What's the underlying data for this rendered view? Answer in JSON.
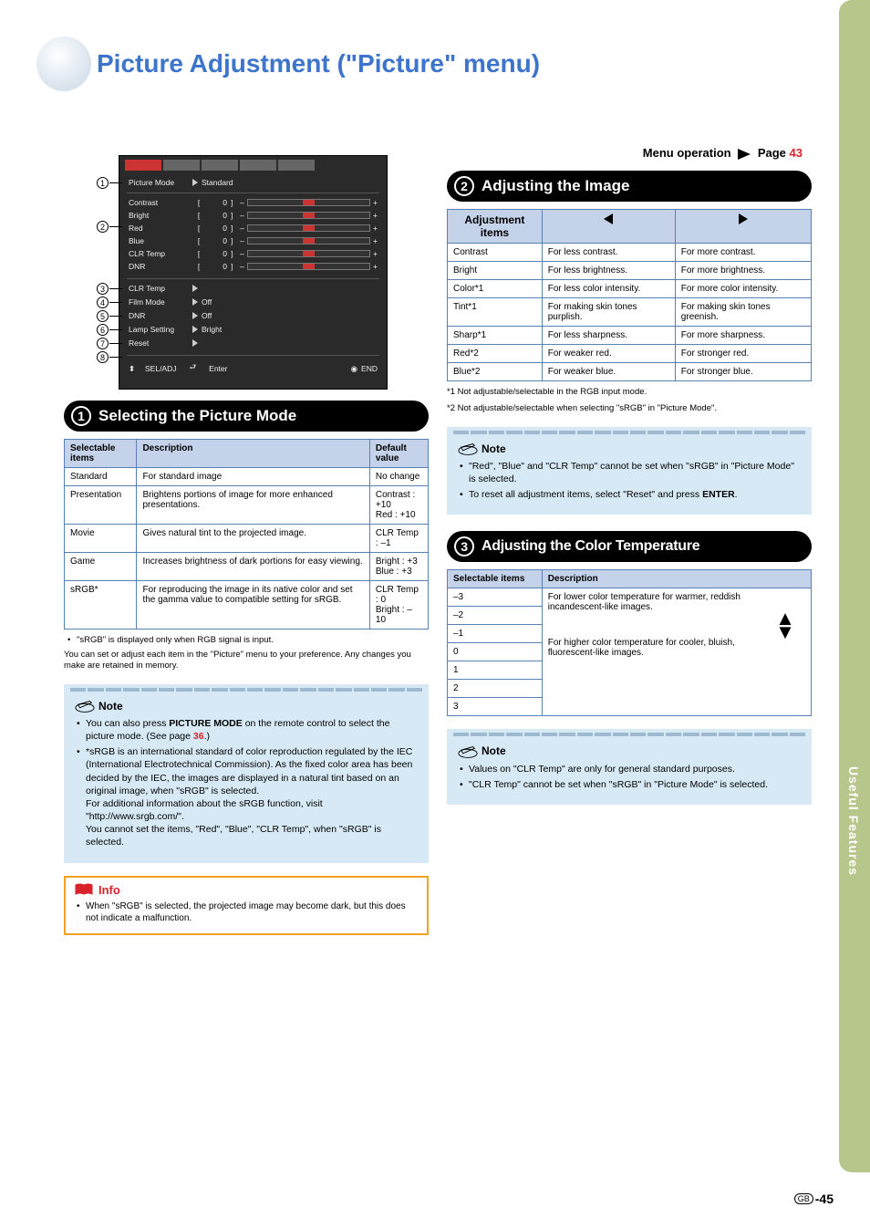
{
  "page": {
    "title": "Picture Adjustment (\"Picture\" menu)",
    "menu_operation_label": "Menu operation",
    "menu_operation_page_label": "Page",
    "menu_operation_page_num": "43",
    "side_tab": "Useful Features",
    "page_number_prefix": "GB",
    "page_number": "-45"
  },
  "callouts": [
    "1",
    "2",
    "3",
    "4",
    "5",
    "6",
    "7",
    "8"
  ],
  "menu_screenshot": {
    "tabs": [
      "Picture"
    ],
    "picture_mode_row": {
      "label": "Picture Mode",
      "value": "Standard"
    },
    "sliders": [
      {
        "label": "Contrast",
        "value": "0"
      },
      {
        "label": "Bright",
        "value": "0"
      },
      {
        "label": "Red",
        "value": "0"
      },
      {
        "label": "Blue",
        "value": "0"
      },
      {
        "label": "CLR Temp",
        "value": "0"
      },
      {
        "label": "DNR",
        "value": "0"
      }
    ],
    "items": [
      {
        "label": "CLR Temp"
      },
      {
        "label": "Film Mode",
        "value": "Off"
      },
      {
        "label": "DNR",
        "value": "Off"
      },
      {
        "label": "Lamp Setting",
        "value": "Bright"
      },
      {
        "label": "Reset"
      }
    ],
    "footer": {
      "sel_adj": "SEL/ADJ",
      "enter": "Enter",
      "end": "END"
    }
  },
  "section1": {
    "title": "Selecting the Picture Mode",
    "num": "1",
    "headers": [
      "Selectable items",
      "Description",
      "Default value"
    ],
    "rows": [
      {
        "c1": "Standard",
        "c2": "For standard image",
        "c3": "No change"
      },
      {
        "c1": "Presentation",
        "c2": "Brightens portions of image for more enhanced presentations.",
        "c3": "Contrast : +10\\nRed : +10"
      },
      {
        "c1": "Movie",
        "c2": "Gives natural tint to the projected image.",
        "c3": "CLR Temp : –1"
      },
      {
        "c1": "Game",
        "c2": "Increases brightness of dark portions for easy viewing.",
        "c3": "Bright : +3\\nBlue : +3"
      },
      {
        "c1": "sRGB*",
        "c2": "For reproducing the image in its native color and set the gamma value to compatible setting for sRGB.",
        "c3": "CLR Temp : 0\\nBright : –10"
      }
    ],
    "footnote": "\"sRGB\" is displayed only when RGB signal is input.",
    "after_table": "You can set or adjust each item in the \"Picture\" menu to your preference. Any changes you make are retained in memory.",
    "note": {
      "title": "Note",
      "items": [
        {
          "text_a": "You can also press ",
          "bold": "PICTURE MODE",
          "text_b": " on the remote control to select the picture mode. (See page ",
          "link": "36",
          "text_c": ".)"
        },
        {
          "full": "*sRGB is an international standard of color reproduction regulated by the IEC (International Electrotechnical Commission). As the fixed color area has been decided by the IEC, the images are displayed in a natural tint based on an original image, when \"sRGB\" is selected.\\nFor additional information about the sRGB function, visit \"http://www.srgb.com/\".\\nYou cannot set the items, \"Red\", \"Blue\", \"CLR Temp\", when \"sRGB\" is selected."
        }
      ]
    },
    "info": {
      "title": "Info",
      "item": "When \"sRGB\" is selected, the projected image may become dark, but this does not indicate a malfunction."
    }
  },
  "section2": {
    "title": "Adjusting the Image",
    "num": "2",
    "head_a": "Adjustment items",
    "rows": [
      {
        "item": "Contrast",
        "l": "For less contrast.",
        "r": "For more contrast."
      },
      {
        "item": "Bright",
        "l": "For less brightness.",
        "r": "For more brightness."
      },
      {
        "item": "Color*1",
        "l": "For less color intensity.",
        "r": "For more color intensity."
      },
      {
        "item": "Tint*1",
        "l": "For making skin tones purplish.",
        "r": "For making skin tones greenish."
      },
      {
        "item": "Sharp*1",
        "l": "For less sharpness.",
        "r": "For more sharpness."
      },
      {
        "item": "Red*2",
        "l": "For weaker red.",
        "r": "For stronger red."
      },
      {
        "item": "Blue*2",
        "l": "For weaker blue.",
        "r": "For stronger blue."
      }
    ],
    "foot1": "*1 Not adjustable/selectable in the RGB input mode.",
    "foot2": "*2 Not adjustable/selectable when selecting \"sRGB\" in \"Picture Mode\".",
    "note": {
      "title": "Note",
      "items": [
        "\"Red\", \"Blue\" and \"CLR Temp\" cannot be set when \"sRGB\" in \"Picture Mode\" is selected.",
        {
          "a": "To reset all adjustment items, select \"Reset\" and press ",
          "bold": "ENTER",
          "b": "."
        }
      ]
    }
  },
  "section3": {
    "title": "Adjusting the Color Temperature",
    "num": "3",
    "headers": [
      "Selectable items",
      "Description"
    ],
    "items": [
      "–3",
      "–2",
      "–1",
      "0",
      "1",
      "2",
      "3"
    ],
    "desc_top": "For lower color temperature for warmer, reddish incandescent-like images.",
    "desc_bot": "For higher color temperature for cooler, bluish, fluorescent-like images.",
    "note": {
      "title": "Note",
      "items": [
        "Values on \"CLR Temp\" are only for general standard purposes.",
        "\"CLR Temp\" cannot be set when \"sRGB\" in \"Picture Mode\" is selected."
      ]
    }
  }
}
